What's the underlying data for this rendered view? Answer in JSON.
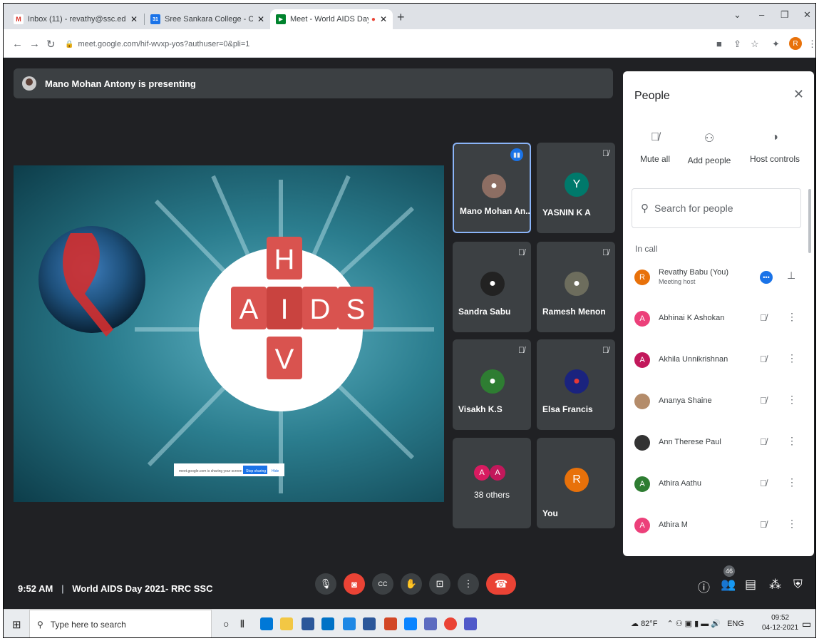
{
  "tabs": [
    {
      "title": "Inbox (11) - revathy@ssc.edu.in -",
      "icon": "gmail-icon",
      "color": "#d93025",
      "letter": "M"
    },
    {
      "title": "Sree Sankara College - Calendar",
      "icon": "calendar-icon",
      "color": "#1a73e8",
      "letter": "31"
    },
    {
      "title": "Meet - World AIDS Day 2021",
      "icon": "meet-icon",
      "color": "#00832d",
      "letter": "▶"
    }
  ],
  "address": "meet.google.com/hif-wvxp-yos?authuser=0&pli=1",
  "presenting": "Mano Mohan Antony is presenting",
  "slide": {
    "letters": [
      "H",
      "A",
      "I",
      "D",
      "S",
      "V"
    ],
    "share_bar_text": "meet.google.com is sharing your screen",
    "share_button": "Stop sharing",
    "hide_text": "Hide"
  },
  "tiles": [
    {
      "name": "Mano Mohan An...",
      "mic": "speaking",
      "type": "photo"
    },
    {
      "name": "YASNIN K A",
      "mic": "muted",
      "type": "initial",
      "initial": "Y",
      "color": "#00796b"
    },
    {
      "name": "Sandra Sabu",
      "mic": "muted",
      "type": "photo"
    },
    {
      "name": "Ramesh Menon",
      "mic": "muted",
      "type": "photo"
    },
    {
      "name": "Visakh K.S",
      "mic": "muted",
      "type": "photo"
    },
    {
      "name": "Elsa Francis",
      "mic": "muted",
      "type": "photo"
    },
    {
      "name": "38 others",
      "type": "group",
      "initials": [
        "A",
        "A"
      ],
      "colors": [
        "#d81b60",
        "#c2185b"
      ]
    },
    {
      "name": "You",
      "type": "initial",
      "initial": "R",
      "color": "#e8710a"
    }
  ],
  "meeting": {
    "time": "9:52 AM",
    "separator": "|",
    "title": "World AIDS Day 2021- RRC SSC",
    "participant_count": "46"
  },
  "people_panel": {
    "title": "People",
    "actions": [
      {
        "label": "Mute all",
        "icon": "mic-off-icon"
      },
      {
        "label": "Add people",
        "icon": "person-add-icon"
      },
      {
        "label": "Host controls",
        "icon": "toggle-icon"
      }
    ],
    "search_placeholder": "Search for people",
    "section": "In call",
    "participants": [
      {
        "name": "Revathy Babu (You)",
        "sub": "Meeting host",
        "initial": "R",
        "color": "#e8710a"
      },
      {
        "name": "Abhinai K Ashokan",
        "initial": "A",
        "color": "#ec407a"
      },
      {
        "name": "Akhila Unnikrishnan",
        "initial": "A",
        "color": "#c2185b"
      },
      {
        "name": "Ananya Shaine",
        "initial": "",
        "color": "#b48c6a"
      },
      {
        "name": "Ann Therese Paul",
        "initial": "",
        "color": "#333333"
      },
      {
        "name": "Athira Aathu",
        "initial": "A",
        "color": "#2e7d32"
      },
      {
        "name": "Athira M",
        "initial": "A",
        "color": "#ec407a"
      }
    ]
  },
  "taskbar": {
    "search": "Type here to search",
    "weather": "82°F",
    "lang": "ENG",
    "time": "09:52",
    "date": "04-12-2021"
  }
}
